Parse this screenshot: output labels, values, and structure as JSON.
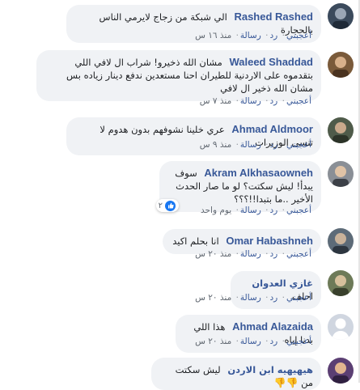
{
  "action_labels": {
    "like": "أعجبني",
    "reply": "رد",
    "message": "رسالة"
  },
  "comments": [
    {
      "author": "Rashed Rashed",
      "text": "الي شبكة من زجاج لايرمي الناس بالحجارة",
      "time": "منذ ١٦ س"
    },
    {
      "author": "Waleed Shaddad",
      "text": "مشان الله ذخيرو! شراب ال لافي اللي بتقدموه على الاردنية للطيران احنا مستعدين ندفع دينار زياده بس مشان الله ذخير ال لافي",
      "time": "منذ ٧ س"
    },
    {
      "author": "Ahmad Aldmoor",
      "text": "عري خلينا نشوفهم بدون هدوم لا تنسى الوزيرات",
      "time": "منذ ٩ س"
    },
    {
      "author": "Akram Alkhasaowneh",
      "text": "سوف يبدأ! ليش سكتت؟ لو ما صار الحدث الأخير ..ما بتبدا!!؟؟؟",
      "time": "يوم واحد",
      "reactions": "٢"
    },
    {
      "author": "Omar Habashneh",
      "text": "انا بحلم اكيد",
      "time": "منذ ٢٠ س"
    },
    {
      "author": "غازي العدوان",
      "text": "احلف",
      "time": "منذ ٢٠ س"
    },
    {
      "author": "Ahmad Alazaida",
      "text": "هذا اللي بدنا إياه",
      "time": "منذ ٢٠ س"
    },
    {
      "author": "هيهيهيه ابن الاردن",
      "text": "ليش سكتت من",
      "time": ""
    }
  ]
}
